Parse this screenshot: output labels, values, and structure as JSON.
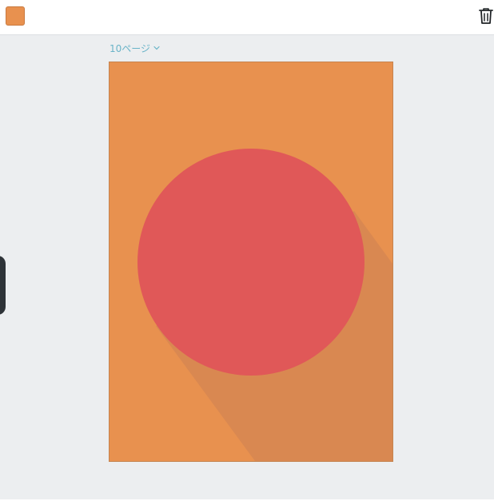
{
  "toolbar": {
    "swatch_color": "#e8914f",
    "swatch_icon": "color-swatch",
    "delete_icon": "trash-icon"
  },
  "workspace": {
    "background": "#eceef0",
    "pages_label": "10ページ",
    "pages_chevron_icon": "chevron-down-icon"
  },
  "design": {
    "background_color": "#e8914f",
    "circle_color": "#e05858",
    "shadow_color": "#d98851"
  },
  "side_panel": {
    "color": "#2e3338"
  }
}
